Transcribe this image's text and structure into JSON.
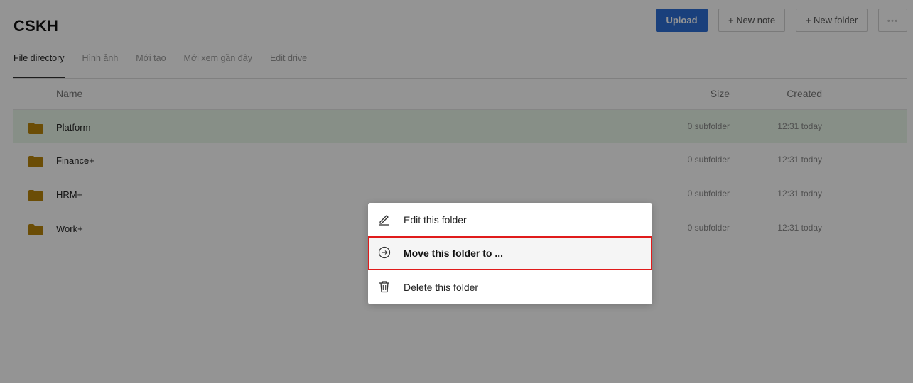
{
  "page": {
    "title": "CSKH"
  },
  "toolbar": {
    "upload_label": "Upload",
    "new_note_label": "+ New note",
    "new_folder_label": "+ New folder",
    "more_label": "◦◦◦"
  },
  "tabs": [
    {
      "label": "File directory",
      "active": true
    },
    {
      "label": "Hình ảnh",
      "active": false
    },
    {
      "label": "Mới tạo",
      "active": false
    },
    {
      "label": "Mới xem gần đây",
      "active": false
    },
    {
      "label": "Edit drive",
      "active": false
    }
  ],
  "table": {
    "columns": {
      "name": "Name",
      "size": "Size",
      "created": "Created"
    },
    "rows": [
      {
        "name": "Platform",
        "size": "0 subfolder",
        "created": "12:31 today",
        "selected": true
      },
      {
        "name": "Finance+",
        "size": "0 subfolder",
        "created": "12:31 today",
        "selected": false
      },
      {
        "name": "HRM+",
        "size": "0 subfolder",
        "created": "12:31 today",
        "selected": false
      },
      {
        "name": "Work+",
        "size": "0 subfolder",
        "created": "12:31 today",
        "selected": false
      }
    ]
  },
  "context_menu": {
    "items": [
      {
        "label": "Edit this folder",
        "icon": "pencil-icon"
      },
      {
        "label": "Move this folder to ...",
        "icon": "arrow-circle-right-icon",
        "highlighted": true
      },
      {
        "label": "Delete this folder",
        "icon": "trash-icon"
      }
    ]
  },
  "colors": {
    "accent": "#2d6fd6",
    "folder": "#b8860b",
    "highlight_border": "#e01b1b",
    "selected_row": "#e9f7e9"
  }
}
